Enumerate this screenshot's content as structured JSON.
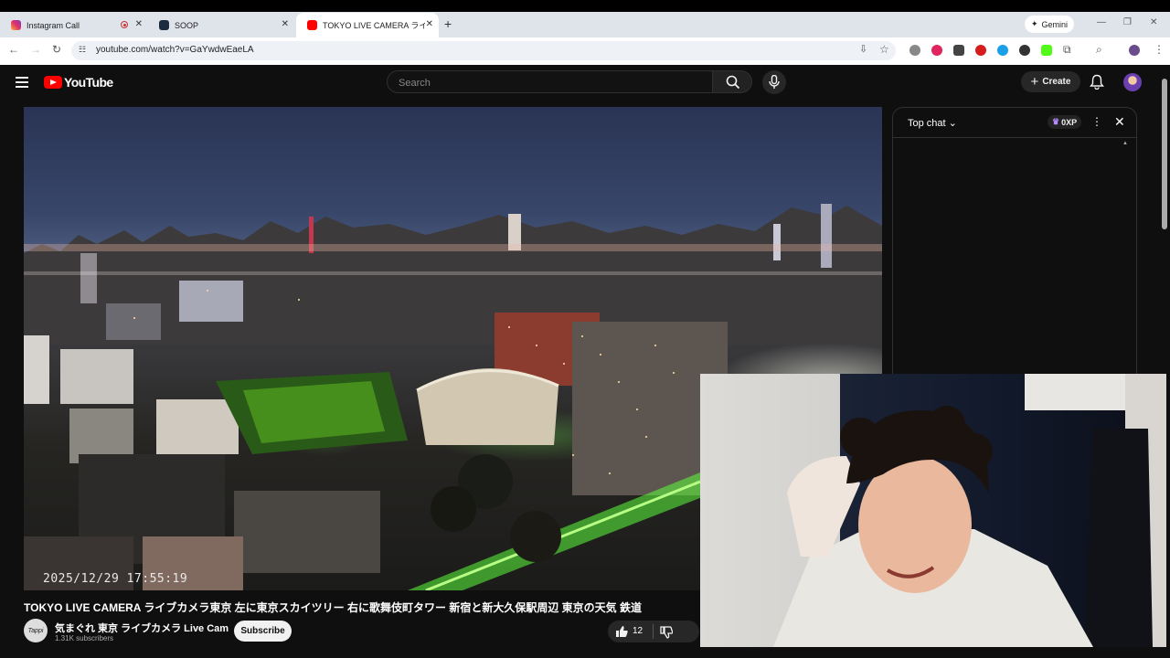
{
  "browser": {
    "tabs": [
      {
        "title": "Instagram Call",
        "active": false,
        "recording": true
      },
      {
        "title": "SOOP",
        "active": false
      },
      {
        "title": "TOKYO LIVE CAMERA ライブカメ",
        "active": true
      }
    ],
    "new_tab_label": "+",
    "gemini_label": "Gemini",
    "url": "youtube.com/watch?v=GaYwdwEaeLA"
  },
  "youtube": {
    "logo_text": "YouTube",
    "search_placeholder": "Search",
    "create_label": "Create"
  },
  "player": {
    "timestamp_overlay": "2025/12/29 17:55:19"
  },
  "chat": {
    "title": "Top chat",
    "xp_label": "0XP"
  },
  "video": {
    "title": "TOKYO LIVE CAMERA ライブカメラ東京 左に東京スカイツリー 右に歌舞伎町タワー 新宿と新大久保駅周辺 東京の天気 鉄道",
    "channel_name": "気まぐれ 東京 ライブカメラ Live Cam",
    "channel_avatar_text": "Tappi",
    "subscribers": "1.31K subscribers",
    "subscribe_label": "Subscribe",
    "like_count": "12"
  },
  "colors": {
    "yt_red": "#ff0000",
    "yt_bg": "#0f0f0f",
    "tab_strip": "#dfe3ea"
  }
}
